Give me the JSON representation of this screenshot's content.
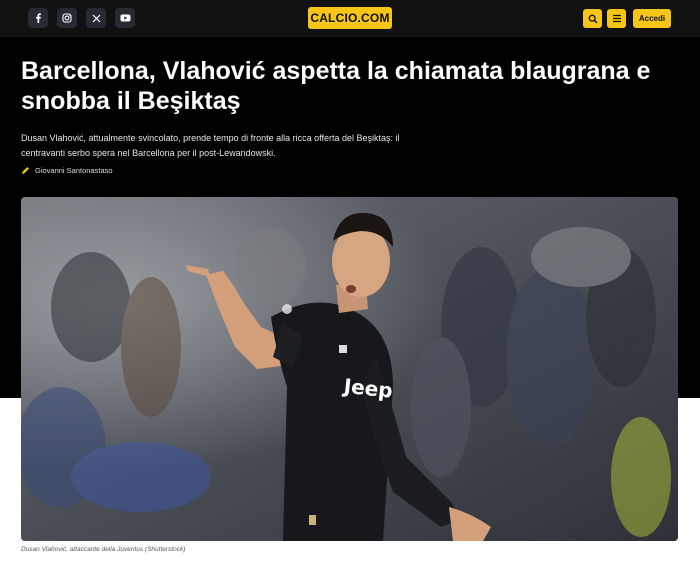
{
  "header": {
    "social": [
      {
        "name": "facebook-icon",
        "glyph": "f"
      },
      {
        "name": "instagram-icon",
        "glyph": "ig"
      },
      {
        "name": "x-icon",
        "glyph": "X"
      },
      {
        "name": "youtube-icon",
        "glyph": "yt"
      }
    ],
    "logo": "CALCIO.COM",
    "login_label": "Accedi",
    "colors": {
      "accent": "#f5c518",
      "bar": "#111111"
    }
  },
  "article": {
    "title": "Barcellona, Vlahović aspetta la chiamata blaugrana e snobba il Beşiktaş",
    "description": "Dusan Vlahović, attualmente svincolato, prende tempo di fronte alla ricca offerta del Beşiktaş: il centravanti serbo spera nel Barcellona per il post-Lewandowski.",
    "author": "Giovanni Santonastaso",
    "caption": "Dusan Vlahović, attaccante della Juventus (Shutterstock)",
    "image": {
      "subject": "football player in black jersey pointing",
      "jersey_text": "Jeep"
    }
  }
}
